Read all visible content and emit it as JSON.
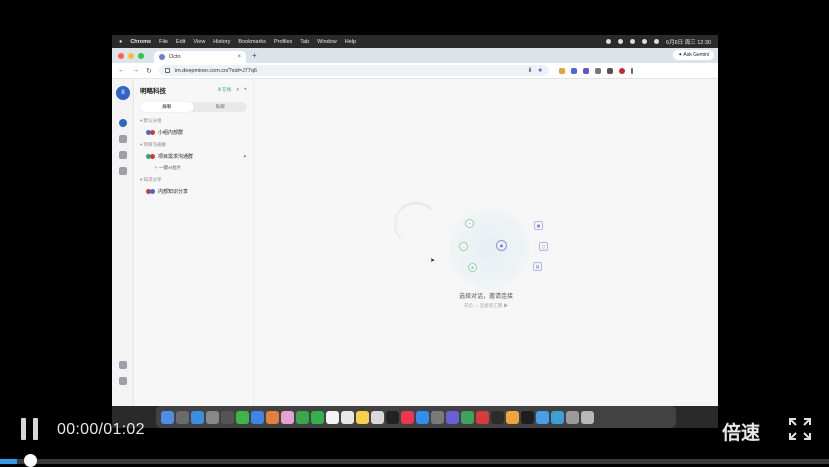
{
  "menubar": {
    "items": [
      "Chrome",
      "File",
      "Edit",
      "View",
      "History",
      "Bookmarks",
      "Profiles",
      "Tab",
      "Window",
      "Help"
    ],
    "clock": "6月6日 周三 12:30"
  },
  "browser": {
    "tab_title": "Octo",
    "tab_close": "×",
    "new_tab": "+",
    "ask_gemini": "✦ Ask Gemini",
    "url": "im.deepminer.com.cn/?sid=J77q6"
  },
  "app": {
    "avatar_initial": "8",
    "brand": "明略科技",
    "online_status": "Ⅲ 在线",
    "segments": [
      "群聊",
      "私聊"
    ],
    "groups": [
      {
        "label": "默认分组",
        "items": [
          {
            "name": "小组内部群"
          }
        ]
      },
      {
        "label": "项目沟通群",
        "items": [
          {
            "name": "项目需求沟通群",
            "pinned": true,
            "sub": "一键AI拉片"
          }
        ]
      },
      {
        "label": "知识分享",
        "items": [
          {
            "name": "内部知识分享"
          }
        ]
      }
    ],
    "empty_title": "选择对话，邀请连接",
    "empty_sub": "开启 ↔ 连接新汇聚 ▶"
  },
  "player": {
    "timecode": "00:00/01:02",
    "speed_label": "倍速",
    "progress": 0.02
  },
  "colors": {
    "accent": "#2f64c9",
    "progress": "#2e9cf0",
    "online": "#3cae5c"
  }
}
